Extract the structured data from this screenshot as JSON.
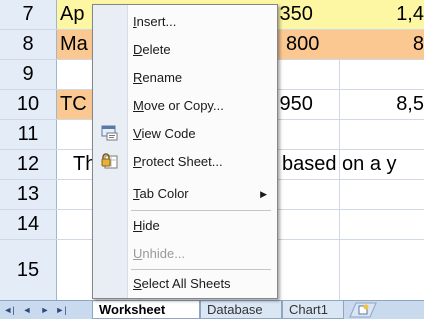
{
  "colors": {
    "header_bg": "#e4ecf7",
    "yellow": "#fdf7a4",
    "orange": "#fbc892",
    "grid_line": "#d0d7e5",
    "menu_bg": "#fbfbfb",
    "tabbar_bg": "#c9d9ee"
  },
  "rows": [
    {
      "num": "7",
      "b": "Ap",
      "d": ",350",
      "e": "1,4"
    },
    {
      "num": "8",
      "b": "Ma",
      "d": "800",
      "e": "8"
    },
    {
      "num": "9",
      "b": "",
      "d": "",
      "e": ""
    },
    {
      "num": "10",
      "b": "TC",
      "d": ",950",
      "e": "8,5"
    },
    {
      "num": "11",
      "b": "",
      "d": "",
      "e": ""
    },
    {
      "num": "12",
      "b": "Th",
      "d": "based on a y",
      "e": ""
    },
    {
      "num": "13",
      "b": "",
      "d": "",
      "e": ""
    },
    {
      "num": "14",
      "b": "",
      "d": "",
      "e": ""
    },
    {
      "num": "15",
      "b": "",
      "d": "",
      "e": ""
    }
  ],
  "context_menu": {
    "items": [
      {
        "pre": "",
        "u": "I",
        "post": "nsert...",
        "enabled": true,
        "icon": ""
      },
      {
        "pre": "",
        "u": "D",
        "post": "elete",
        "enabled": true,
        "icon": ""
      },
      {
        "pre": "",
        "u": "R",
        "post": "ename",
        "enabled": true,
        "icon": ""
      },
      {
        "pre": "",
        "u": "M",
        "post": "ove or Copy...",
        "enabled": true,
        "icon": ""
      },
      {
        "pre": "",
        "u": "V",
        "post": "iew Code",
        "enabled": true,
        "icon": "view-code-icon"
      },
      {
        "pre": "",
        "u": "P",
        "post": "rotect Sheet...",
        "enabled": true,
        "icon": "protect-sheet-icon"
      },
      {
        "pre": "",
        "u": "T",
        "post": "ab Color",
        "enabled": true,
        "icon": "",
        "submenu": true
      },
      {
        "pre": "",
        "u": "H",
        "post": "ide",
        "enabled": true,
        "icon": ""
      },
      {
        "pre": "",
        "u": "U",
        "post": "nhide...",
        "enabled": false,
        "icon": ""
      },
      {
        "pre": "",
        "u": "S",
        "post": "elect All Sheets",
        "enabled": true,
        "icon": ""
      }
    ]
  },
  "sheet_tabs": {
    "nav": [
      "first-sheet-icon",
      "prev-sheet-icon",
      "next-sheet-icon",
      "last-sheet-icon"
    ],
    "tabs": [
      {
        "label": "Worksheet",
        "active": true
      },
      {
        "label": "Database",
        "active": false
      },
      {
        "label": "Chart1",
        "active": false
      }
    ],
    "insert_icon": "insert-sheet-icon"
  }
}
